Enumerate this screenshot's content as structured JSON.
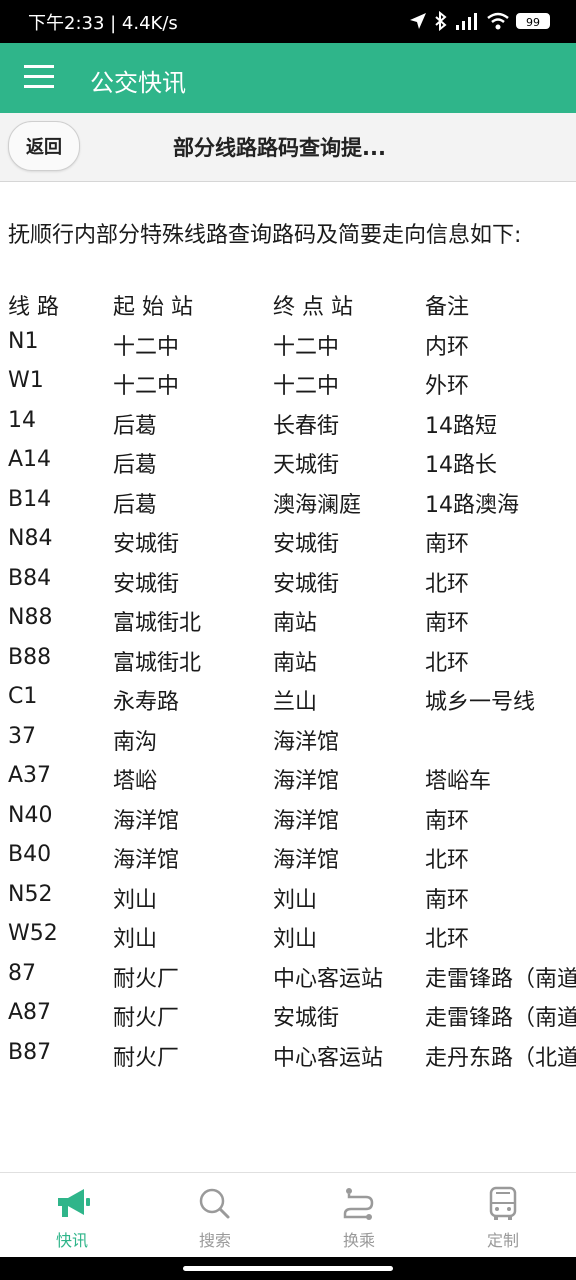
{
  "status": {
    "time": "下午2:33 | 4.4K/s",
    "battery": "99"
  },
  "app": {
    "title": "公交快讯"
  },
  "subheader": {
    "back_label": "返回",
    "title": "部分线路路码查询提..."
  },
  "content": {
    "intro": "抚顺行内部分特殊线路查询路码及简要走向信息如下:",
    "headers": [
      "线 路",
      "起 始 站",
      "终 点 站",
      "备注"
    ],
    "rows": [
      [
        "N1",
        "十二中",
        "十二中",
        "内环"
      ],
      [
        "W1",
        "十二中",
        "十二中",
        "外环"
      ],
      [
        "14",
        "后葛",
        "长春街",
        "14路短"
      ],
      [
        "A14",
        "后葛",
        "天城街",
        "14路长"
      ],
      [
        "B14",
        "后葛",
        "澳海澜庭",
        "14路澳海"
      ],
      [
        "N84",
        "安城街",
        "安城街",
        "南环"
      ],
      [
        "B84",
        "安城街",
        "安城街",
        "北环"
      ],
      [
        "N88",
        "富城街北",
        "南站",
        "南环"
      ],
      [
        "B88",
        "富城街北",
        "南站",
        "北环"
      ],
      [
        "C1",
        "永寿路",
        "兰山",
        "城乡一号线"
      ],
      [
        "37",
        "南沟",
        "海洋馆",
        ""
      ],
      [
        "A37",
        "塔峪",
        "海洋馆",
        "塔峪车"
      ],
      [
        "N40",
        "海洋馆",
        "海洋馆",
        "南环"
      ],
      [
        "B40",
        "海洋馆",
        "海洋馆",
        "北环"
      ],
      [
        "N52",
        "刘山",
        "刘山",
        "南环"
      ],
      [
        "W52",
        "刘山",
        "刘山",
        "北环"
      ],
      [
        "87",
        "耐火厂",
        "中心客运站",
        "走雷锋路（南道"
      ],
      [
        "A87",
        "耐火厂",
        "安城街",
        "走雷锋路（南道"
      ],
      [
        "B87",
        "耐火厂",
        "中心客运站",
        "走丹东路（北道"
      ]
    ]
  },
  "tabs": [
    {
      "label": "快讯",
      "icon": "megaphone-icon",
      "active": true
    },
    {
      "label": "搜索",
      "icon": "search-icon",
      "active": false
    },
    {
      "label": "换乘",
      "icon": "transfer-icon",
      "active": false
    },
    {
      "label": "定制",
      "icon": "bus-icon",
      "active": false
    }
  ],
  "colors": {
    "accent": "#2fb58a",
    "inactive": "#9a9a9a"
  }
}
